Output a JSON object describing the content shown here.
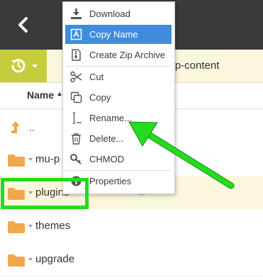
{
  "window": {
    "back_icon": "chevron-left-icon"
  },
  "toolbar": {
    "history_icon": "history-icon",
    "path_fragment": "wp-content"
  },
  "columns": {
    "name_label": "Name",
    "sort": "ascending"
  },
  "rows": [
    {
      "kind": "parent",
      "name": "..",
      "icon": "up-arrow-icon"
    },
    {
      "kind": "folder",
      "name": "mu-p",
      "icon": "folder-icon"
    },
    {
      "kind": "folder",
      "name": "plugins",
      "icon": "folder-icon",
      "selected": true
    },
    {
      "kind": "folder",
      "name": "themes",
      "icon": "folder-icon"
    },
    {
      "kind": "folder",
      "name": "upgrade",
      "icon": "folder-icon"
    }
  ],
  "context_menu": {
    "items": [
      {
        "label": "Download",
        "icon": "download-icon"
      },
      {
        "label": "Copy Name",
        "icon": "copy-name-icon",
        "highlighted": true
      },
      {
        "label": "Create Zip Archive",
        "icon": "zip-archive-icon"
      },
      {
        "label": "Cut",
        "icon": "scissors-icon"
      },
      {
        "label": "Copy",
        "icon": "copy-icon"
      },
      {
        "label": "Rename...",
        "icon": "text-cursor-icon"
      },
      {
        "label": "Delete...",
        "icon": "trash-icon"
      },
      {
        "label": "CHMOD",
        "icon": "key-icon"
      },
      {
        "label": "Properties",
        "icon": "info-icon"
      }
    ]
  },
  "annotation": {
    "highlight_color": "#22dd1e",
    "accent": "#3e8ddd",
    "toolbar_accent": "#c5cd3d",
    "folder_color": "#f0a84d"
  }
}
